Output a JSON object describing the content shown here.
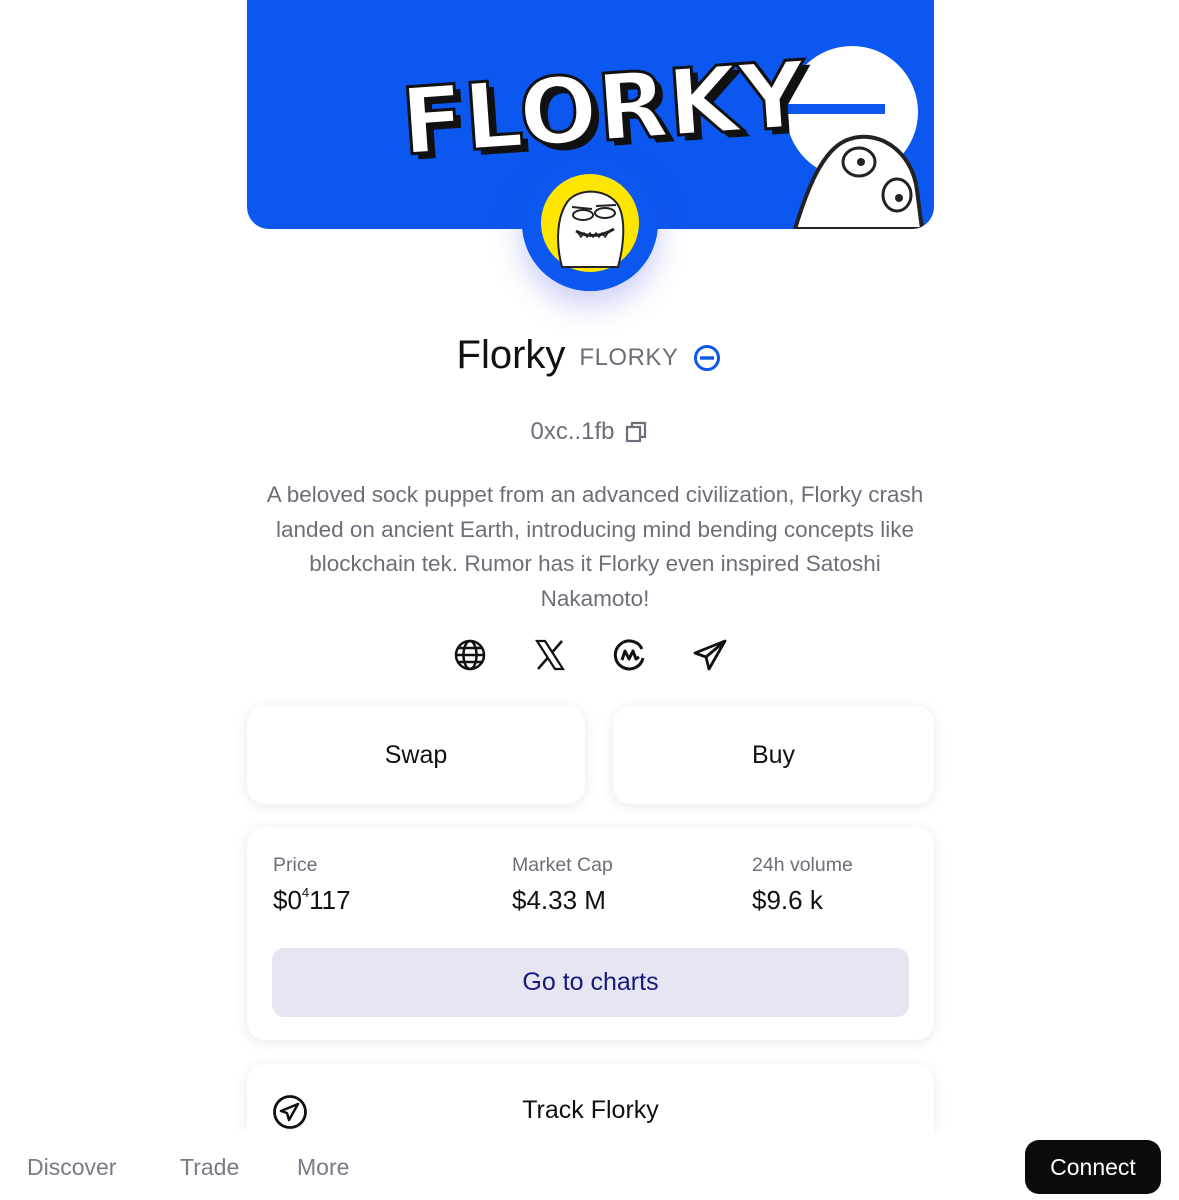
{
  "banner": {
    "logo_text": "FLORKY"
  },
  "token": {
    "name": "Florky",
    "symbol": "FLORKY",
    "address": "0xc..1fb",
    "description": "A beloved sock puppet from an advanced civilization, Florky crash landed on ancient Earth, introducing mind bending concepts like blockchain tek. Rumor has it Florky even inspired Satoshi Nakamoto!"
  },
  "socials": [
    "globe-icon",
    "x-icon",
    "coinmarketcap-icon",
    "telegram-icon"
  ],
  "actions": {
    "swap": "Swap",
    "buy": "Buy"
  },
  "stats": {
    "price_label": "Price",
    "price_prefix": "$0",
    "price_sup": "4",
    "price_digits": "117",
    "mcap_label": "Market Cap",
    "mcap_value": "$4.33 M",
    "volume_label": "24h volume",
    "volume_value": "$9.6 k",
    "charts_button": "Go to charts"
  },
  "track": {
    "label": "Track Florky"
  },
  "nav": {
    "discover": "Discover",
    "trade": "Trade",
    "more": "More",
    "connect": "Connect"
  },
  "colors": {
    "brand_blue": "#0b57f0",
    "charts_button_bg": "#e6e6f3",
    "charts_button_text": "#15197a"
  }
}
